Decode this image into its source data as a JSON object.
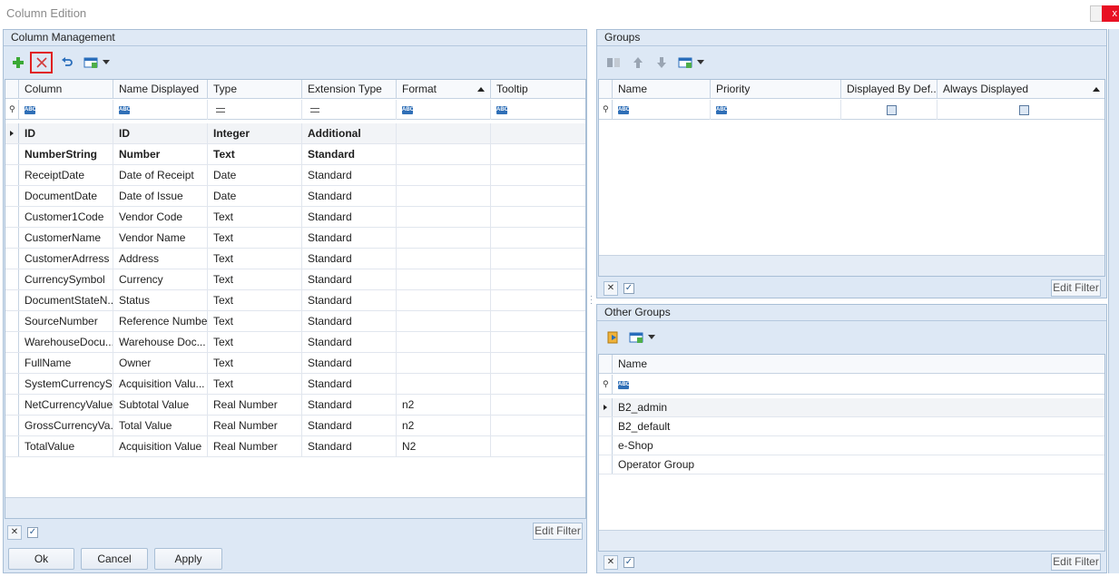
{
  "window": {
    "title": "Column Edition",
    "close_glyph": "x"
  },
  "column_management": {
    "title": "Column Management",
    "toolbar": [
      "add-icon",
      "delete-icon",
      "undo-icon",
      "layout-icon",
      "dropdown-icon"
    ],
    "columns": [
      "Column",
      "Name Displayed",
      "Type",
      "Extension Type",
      "Format",
      "Tooltip"
    ],
    "rows": [
      [
        "ID",
        "ID",
        "Integer",
        "Additional",
        "",
        ""
      ],
      [
        "NumberString",
        "Number",
        "Text",
        "Standard",
        "",
        ""
      ],
      [
        "ReceiptDate",
        "Date of Receipt",
        "Date",
        "Standard",
        "",
        ""
      ],
      [
        "DocumentDate",
        "Date of Issue",
        "Date",
        "Standard",
        "",
        ""
      ],
      [
        "Customer1Code",
        "Vendor Code",
        "Text",
        "Standard",
        "",
        ""
      ],
      [
        "CustomerName",
        "Vendor Name",
        "Text",
        "Standard",
        "",
        ""
      ],
      [
        "CustomerAdrress",
        "Address",
        "Text",
        "Standard",
        "",
        ""
      ],
      [
        "CurrencySymbol",
        "Currency",
        "Text",
        "Standard",
        "",
        ""
      ],
      [
        "DocumentStateN...",
        "Status",
        "Text",
        "Standard",
        "",
        ""
      ],
      [
        "SourceNumber",
        "Reference Number",
        "Text",
        "Standard",
        "",
        ""
      ],
      [
        "WarehouseDocu...",
        "Warehouse Doc...",
        "Text",
        "Standard",
        "",
        ""
      ],
      [
        "FullName",
        "Owner",
        "Text",
        "Standard",
        "",
        ""
      ],
      [
        "SystemCurrencyS...",
        "Acquisition Valu...",
        "Text",
        "Standard",
        "",
        ""
      ],
      [
        "NetCurrencyValue",
        "Subtotal Value",
        "Real Number",
        "Standard",
        "n2",
        ""
      ],
      [
        "GrossCurrencyVa...",
        "Total Value",
        "Real Number",
        "Standard",
        "n2",
        ""
      ],
      [
        "TotalValue",
        "Acquisition Value",
        "Real Number",
        "Standard",
        "N2",
        ""
      ]
    ],
    "edit_filter": "Edit Filter"
  },
  "buttons": {
    "ok": "Ok",
    "cancel": "Cancel",
    "apply": "Apply"
  },
  "groups": {
    "title": "Groups",
    "columns": [
      "Name",
      "Priority",
      "Displayed By Def...",
      "Always Displayed"
    ],
    "edit_filter": "Edit Filter"
  },
  "other_groups": {
    "title": "Other Groups",
    "columns": [
      "Name"
    ],
    "rows": [
      "B2_admin",
      "B2_default",
      "e-Shop",
      "Operator Group"
    ],
    "edit_filter": "Edit Filter"
  },
  "accent_colors": {
    "panel": "#dde8f5",
    "border": "#a9bfd6",
    "highlight": "#e02020"
  }
}
